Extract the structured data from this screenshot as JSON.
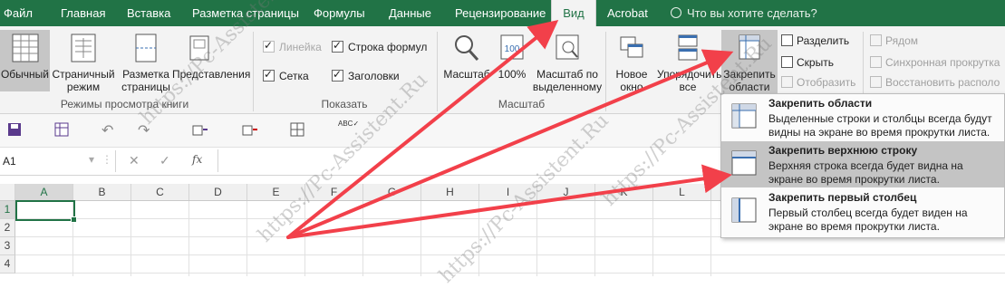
{
  "tabs": [
    "Файл",
    "Главная",
    "Вставка",
    "Разметка страницы",
    "Формулы",
    "Данные",
    "Рецензирование",
    "Вид",
    "Acrobat"
  ],
  "tell_me": "Что вы хотите сделать?",
  "views": {
    "normal": "Обычный",
    "page_layout": [
      "Страничный",
      "режим"
    ],
    "page_break": [
      "Разметка",
      "страницы"
    ],
    "custom": "Представления",
    "group": "Режимы просмотра книги"
  },
  "show": {
    "ruler": "Линейка",
    "formula_bar": "Строка формул",
    "gridlines": "Сетка",
    "headings": "Заголовки",
    "group": "Показать"
  },
  "zoom": {
    "zoom": "Масштаб",
    "p100": "100%",
    "zoom_sel": [
      "Масштаб по",
      "выделенному"
    ],
    "group": "Масштаб"
  },
  "window": {
    "new": [
      "Новое",
      "окно"
    ],
    "arrange": [
      "Упорядочить",
      "все"
    ],
    "freeze": [
      "Закрепить",
      "области"
    ],
    "split": "Разделить",
    "hide": "Скрыть",
    "unhide": "Отобразить",
    "side": "Рядом",
    "sync": "Синхронная прокрутка",
    "reset": "Восстановить располо"
  },
  "namebox": "A1",
  "fx": "fx",
  "columns": [
    "A",
    "B",
    "C",
    "D",
    "E",
    "F",
    "G",
    "H",
    "I",
    "J",
    "K",
    "L"
  ],
  "rows": [
    "1",
    "2",
    "3",
    "4"
  ],
  "menu": [
    {
      "title": "Закрепить области",
      "desc": "Выделенные строки и столбцы всегда будут видны на экране во время прокрутки листа."
    },
    {
      "title": "Закрепить верхнюю строку",
      "desc": "Верхняя строка всегда будет видна на экране во время прокрутки листа."
    },
    {
      "title": "Закрепить первый столбец",
      "desc": "Первый столбец всегда будет виден на экране во время прокрутки листа."
    }
  ],
  "watermark": "https://Pc-Assistent.Ru",
  "colors": {
    "excel_green": "#217346",
    "arrow": "#f2404a"
  }
}
